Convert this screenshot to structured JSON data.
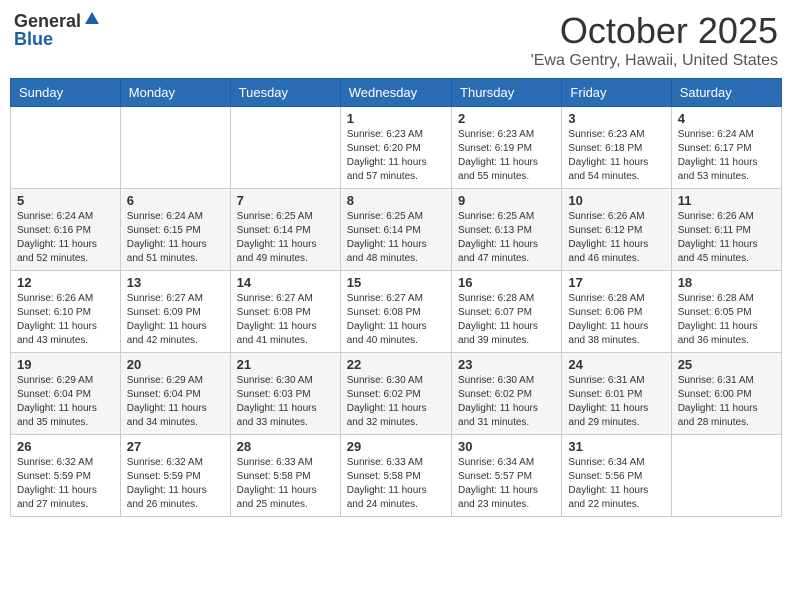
{
  "header": {
    "logo_general": "General",
    "logo_blue": "Blue",
    "month_title": "October 2025",
    "location": "'Ewa Gentry, Hawaii, United States"
  },
  "weekdays": [
    "Sunday",
    "Monday",
    "Tuesday",
    "Wednesday",
    "Thursday",
    "Friday",
    "Saturday"
  ],
  "weeks": [
    [
      {
        "day": "",
        "info": ""
      },
      {
        "day": "",
        "info": ""
      },
      {
        "day": "",
        "info": ""
      },
      {
        "day": "1",
        "info": "Sunrise: 6:23 AM\nSunset: 6:20 PM\nDaylight: 11 hours\nand 57 minutes."
      },
      {
        "day": "2",
        "info": "Sunrise: 6:23 AM\nSunset: 6:19 PM\nDaylight: 11 hours\nand 55 minutes."
      },
      {
        "day": "3",
        "info": "Sunrise: 6:23 AM\nSunset: 6:18 PM\nDaylight: 11 hours\nand 54 minutes."
      },
      {
        "day": "4",
        "info": "Sunrise: 6:24 AM\nSunset: 6:17 PM\nDaylight: 11 hours\nand 53 minutes."
      }
    ],
    [
      {
        "day": "5",
        "info": "Sunrise: 6:24 AM\nSunset: 6:16 PM\nDaylight: 11 hours\nand 52 minutes."
      },
      {
        "day": "6",
        "info": "Sunrise: 6:24 AM\nSunset: 6:15 PM\nDaylight: 11 hours\nand 51 minutes."
      },
      {
        "day": "7",
        "info": "Sunrise: 6:25 AM\nSunset: 6:14 PM\nDaylight: 11 hours\nand 49 minutes."
      },
      {
        "day": "8",
        "info": "Sunrise: 6:25 AM\nSunset: 6:14 PM\nDaylight: 11 hours\nand 48 minutes."
      },
      {
        "day": "9",
        "info": "Sunrise: 6:25 AM\nSunset: 6:13 PM\nDaylight: 11 hours\nand 47 minutes."
      },
      {
        "day": "10",
        "info": "Sunrise: 6:26 AM\nSunset: 6:12 PM\nDaylight: 11 hours\nand 46 minutes."
      },
      {
        "day": "11",
        "info": "Sunrise: 6:26 AM\nSunset: 6:11 PM\nDaylight: 11 hours\nand 45 minutes."
      }
    ],
    [
      {
        "day": "12",
        "info": "Sunrise: 6:26 AM\nSunset: 6:10 PM\nDaylight: 11 hours\nand 43 minutes."
      },
      {
        "day": "13",
        "info": "Sunrise: 6:27 AM\nSunset: 6:09 PM\nDaylight: 11 hours\nand 42 minutes."
      },
      {
        "day": "14",
        "info": "Sunrise: 6:27 AM\nSunset: 6:08 PM\nDaylight: 11 hours\nand 41 minutes."
      },
      {
        "day": "15",
        "info": "Sunrise: 6:27 AM\nSunset: 6:08 PM\nDaylight: 11 hours\nand 40 minutes."
      },
      {
        "day": "16",
        "info": "Sunrise: 6:28 AM\nSunset: 6:07 PM\nDaylight: 11 hours\nand 39 minutes."
      },
      {
        "day": "17",
        "info": "Sunrise: 6:28 AM\nSunset: 6:06 PM\nDaylight: 11 hours\nand 38 minutes."
      },
      {
        "day": "18",
        "info": "Sunrise: 6:28 AM\nSunset: 6:05 PM\nDaylight: 11 hours\nand 36 minutes."
      }
    ],
    [
      {
        "day": "19",
        "info": "Sunrise: 6:29 AM\nSunset: 6:04 PM\nDaylight: 11 hours\nand 35 minutes."
      },
      {
        "day": "20",
        "info": "Sunrise: 6:29 AM\nSunset: 6:04 PM\nDaylight: 11 hours\nand 34 minutes."
      },
      {
        "day": "21",
        "info": "Sunrise: 6:30 AM\nSunset: 6:03 PM\nDaylight: 11 hours\nand 33 minutes."
      },
      {
        "day": "22",
        "info": "Sunrise: 6:30 AM\nSunset: 6:02 PM\nDaylight: 11 hours\nand 32 minutes."
      },
      {
        "day": "23",
        "info": "Sunrise: 6:30 AM\nSunset: 6:02 PM\nDaylight: 11 hours\nand 31 minutes."
      },
      {
        "day": "24",
        "info": "Sunrise: 6:31 AM\nSunset: 6:01 PM\nDaylight: 11 hours\nand 29 minutes."
      },
      {
        "day": "25",
        "info": "Sunrise: 6:31 AM\nSunset: 6:00 PM\nDaylight: 11 hours\nand 28 minutes."
      }
    ],
    [
      {
        "day": "26",
        "info": "Sunrise: 6:32 AM\nSunset: 5:59 PM\nDaylight: 11 hours\nand 27 minutes."
      },
      {
        "day": "27",
        "info": "Sunrise: 6:32 AM\nSunset: 5:59 PM\nDaylight: 11 hours\nand 26 minutes."
      },
      {
        "day": "28",
        "info": "Sunrise: 6:33 AM\nSunset: 5:58 PM\nDaylight: 11 hours\nand 25 minutes."
      },
      {
        "day": "29",
        "info": "Sunrise: 6:33 AM\nSunset: 5:58 PM\nDaylight: 11 hours\nand 24 minutes."
      },
      {
        "day": "30",
        "info": "Sunrise: 6:34 AM\nSunset: 5:57 PM\nDaylight: 11 hours\nand 23 minutes."
      },
      {
        "day": "31",
        "info": "Sunrise: 6:34 AM\nSunset: 5:56 PM\nDaylight: 11 hours\nand 22 minutes."
      },
      {
        "day": "",
        "info": ""
      }
    ]
  ]
}
